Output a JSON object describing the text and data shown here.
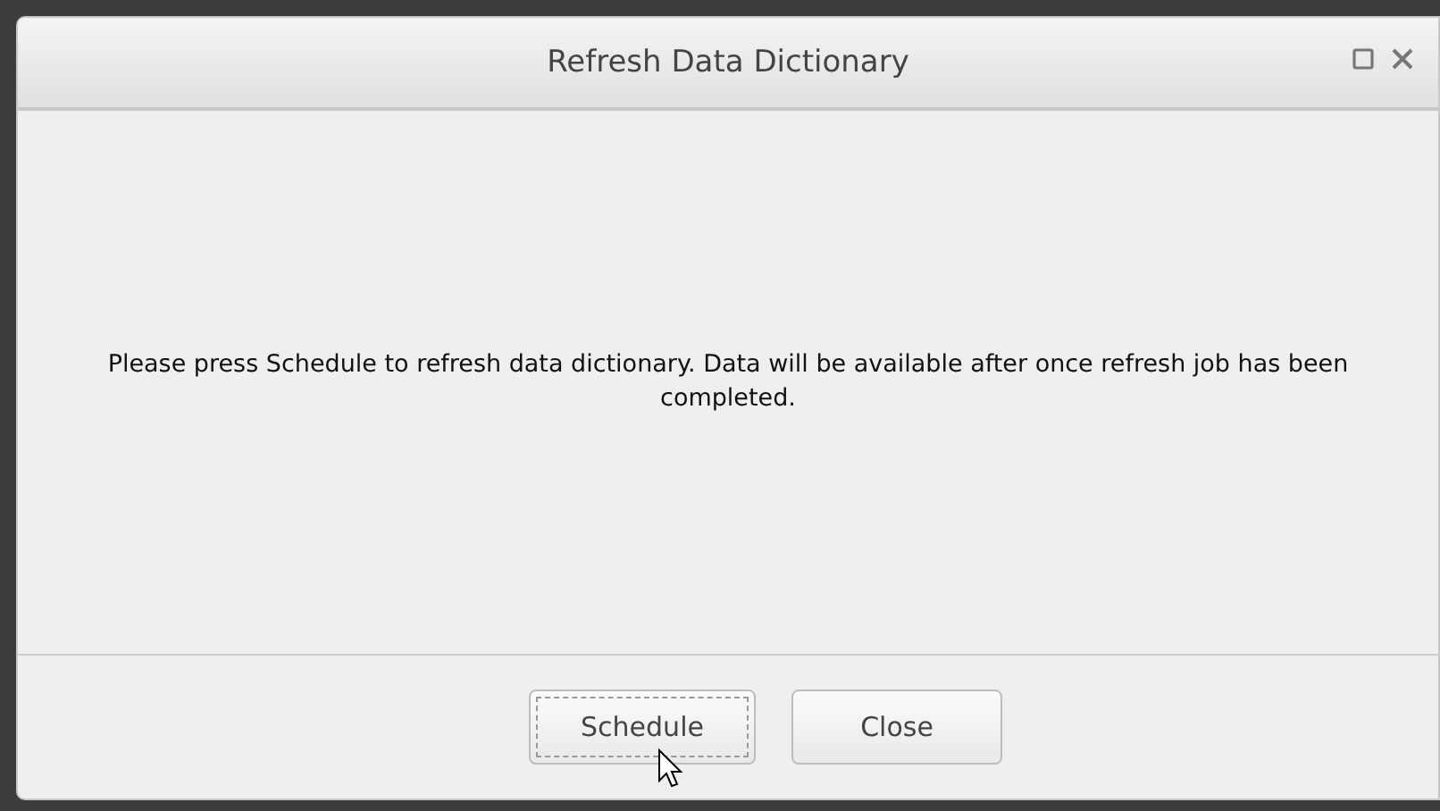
{
  "window": {
    "title": "Refresh Data Dictionary"
  },
  "message": "Please press Schedule to refresh data dictionary. Data will be available after once refresh job has been completed.",
  "buttons": [
    {
      "label": "Schedule",
      "focused": true
    },
    {
      "label": "Close",
      "focused": false
    }
  ]
}
